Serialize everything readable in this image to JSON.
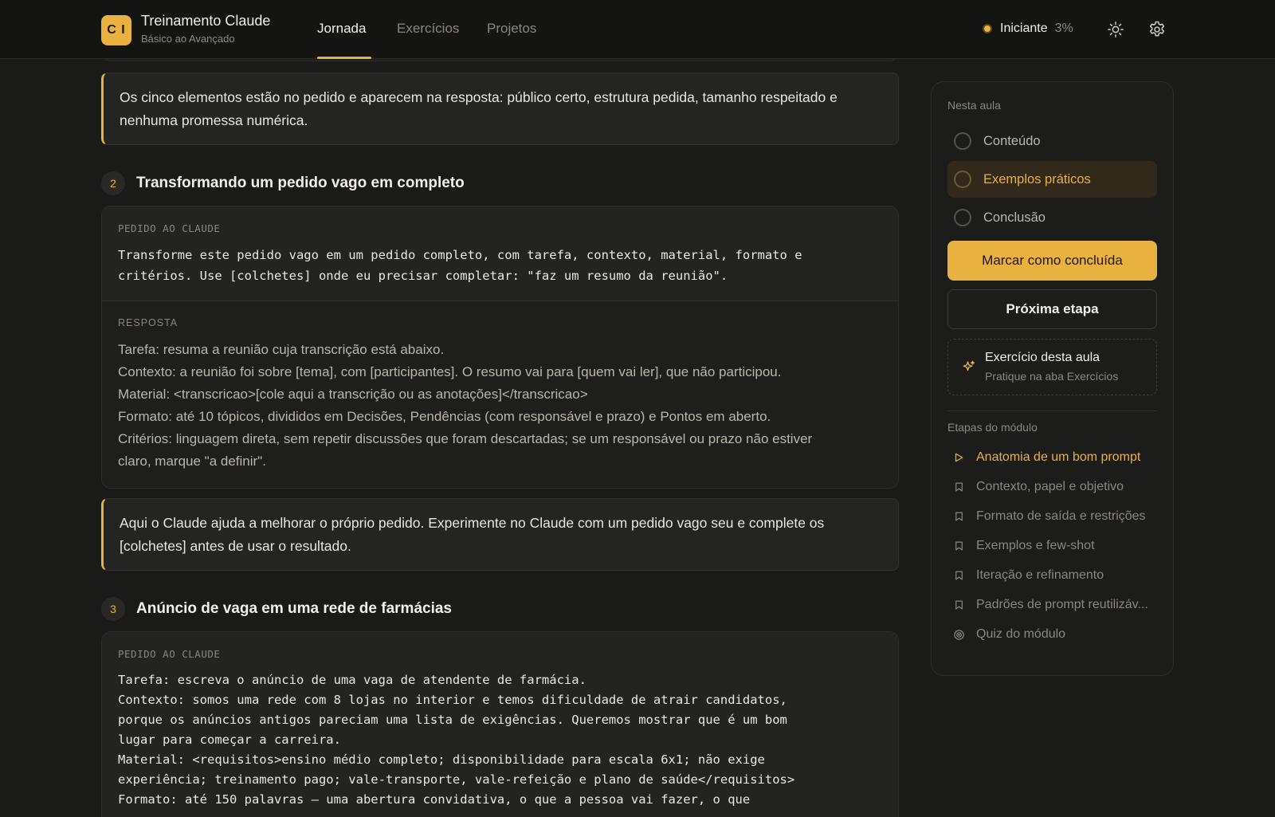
{
  "app": {
    "logo_text": "C I",
    "title": "Treinamento Claude",
    "subtitle": "Básico ao Avançado"
  },
  "nav": {
    "tabs": [
      {
        "label": "Jornada",
        "active": true
      },
      {
        "label": "Exercícios",
        "active": false
      },
      {
        "label": "Projetos",
        "active": false
      }
    ]
  },
  "level": {
    "name": "Iniciante",
    "percent": "3%"
  },
  "icons": {
    "theme": "sun-icon",
    "settings": "gear-icon",
    "exercise": "sparkle-icon"
  },
  "colors": {
    "accent": "#e9b13f",
    "background": "#1a1a19"
  },
  "content": {
    "callout_1": "Os cinco elementos estão no pedido e aparecem na resposta: público certo, estrutura pedida, tamanho respeitado e nenhuma promessa numérica.",
    "section_2": {
      "number": "2",
      "title": "Transformando um pedido vago em completo",
      "prompt_label": "PEDIDO AO CLAUDE",
      "prompt_lines": [
        "Transforme este pedido vago em um pedido completo, com tarefa, contexto, material, formato e",
        "critérios. Use [colchetes] onde eu precisar completar: \"faz um resumo da reunião\"."
      ],
      "response_label": "RESPOSTA",
      "response_lines": [
        "Tarefa: resuma a reunião cuja transcrição está abaixo.",
        "Contexto: a reunião foi sobre [tema], com [participantes]. O resumo vai para [quem vai ler], que não participou.",
        "Material: <transcricao>[cole aqui a transcrição ou as anotações]</transcricao>",
        "Formato: até 10 tópicos, divididos em Decisões, Pendências (com responsável e prazo) e Pontos em aberto.",
        "Critérios: linguagem direta, sem repetir discussões que foram descartadas; se um responsável ou prazo não estiver",
        "claro, marque \"a definir\"."
      ]
    },
    "callout_2": "Aqui o Claude ajuda a melhorar o próprio pedido. Experimente no Claude com um pedido vago seu e complete os [colchetes] antes de usar o resultado.",
    "section_3": {
      "number": "3",
      "title": "Anúncio de vaga em uma rede de farmácias",
      "prompt_label": "PEDIDO AO CLAUDE",
      "prompt_lines": [
        "Tarefa: escreva o anúncio de uma vaga de atendente de farmácia.",
        "Contexto: somos uma rede com 8 lojas no interior e temos dificuldade de atrair candidatos,",
        "porque os anúncios antigos pareciam uma lista de exigências. Queremos mostrar que é um bom",
        "lugar para começar a carreira.",
        "Material: <requisitos>ensino médio completo; disponibilidade para escala 6x1; não exige",
        "experiência; treinamento pago; vale-transporte, vale-refeição e plano de saúde</requisitos>",
        "Formato: até 150 palavras — uma abertura convidativa, o que a pessoa vai fazer, o que"
      ]
    }
  },
  "sidebar": {
    "heading": "Nesta aula",
    "items": [
      {
        "label": "Conteúdo",
        "active": false
      },
      {
        "label": "Exemplos práticos",
        "active": true
      },
      {
        "label": "Conclusão",
        "active": false
      }
    ],
    "primary_button": "Marcar como concluída",
    "secondary_button": "Próxima etapa",
    "exercise": {
      "title": "Exercício desta aula",
      "subtitle": "Pratique na aba Exercícios"
    },
    "steps_heading": "Etapas do módulo",
    "steps": [
      {
        "label": "Anatomia de um bom prompt",
        "icon": "play-icon",
        "current": true
      },
      {
        "label": "Contexto, papel e objetivo",
        "icon": "bookmark-icon",
        "current": false
      },
      {
        "label": "Formato de saída e restrições",
        "icon": "bookmark-icon",
        "current": false
      },
      {
        "label": "Exemplos e few-shot",
        "icon": "bookmark-icon",
        "current": false
      },
      {
        "label": "Iteração e refinamento",
        "icon": "bookmark-icon",
        "current": false
      },
      {
        "label": "Padrões de prompt reutilizáv...",
        "icon": "bookmark-icon",
        "current": false
      },
      {
        "label": "Quiz do módulo",
        "icon": "target-icon",
        "current": false
      }
    ]
  }
}
